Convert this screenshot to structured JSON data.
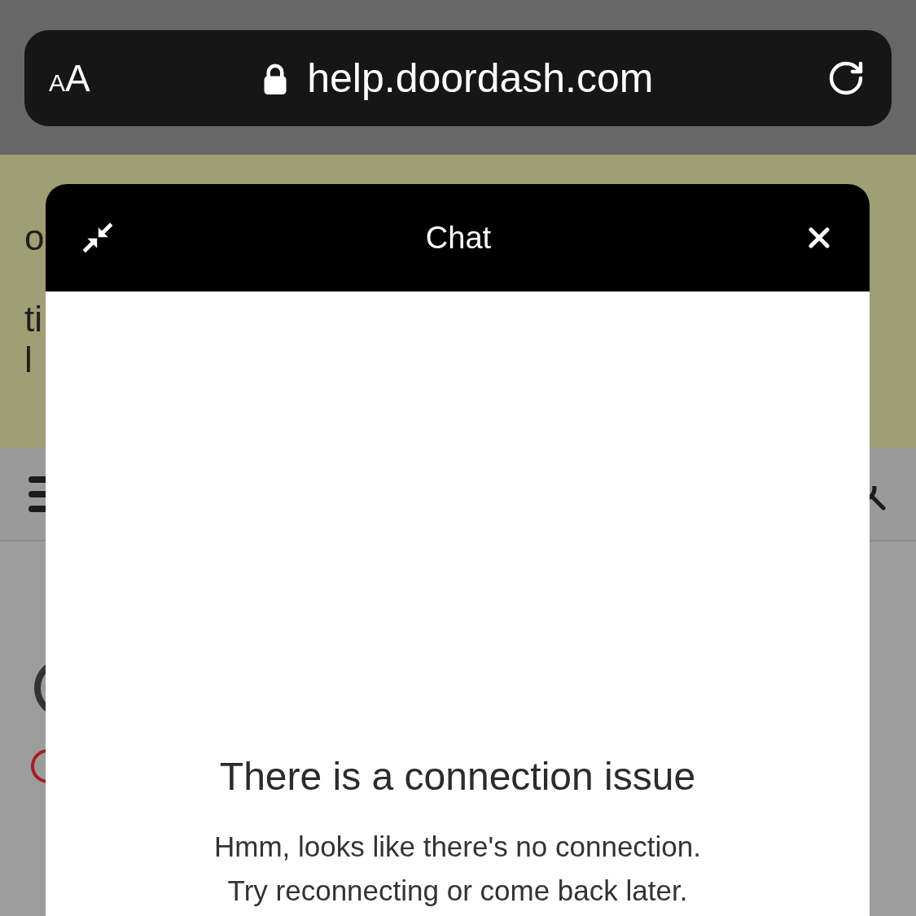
{
  "browser_bar": {
    "text_size_button": {
      "small_letter": "A",
      "large_letter": "A"
    },
    "url": "help.doordash.com"
  },
  "page": {
    "banner_lines": [
      "o",
      "ti",
      "l"
    ]
  },
  "chat": {
    "title": "Chat",
    "heading": "There is a connection issue",
    "message": "Hmm, looks like there's no connection. Try reconnecting or come back later."
  }
}
